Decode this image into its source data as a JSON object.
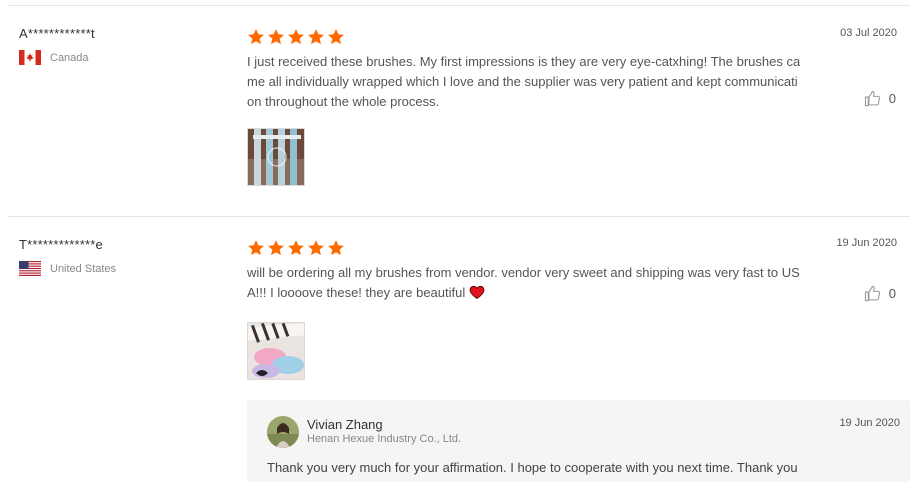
{
  "reviews": [
    {
      "user": "A************t",
      "country": "Canada",
      "rating": 5,
      "date": "03 Jul 2020",
      "text": "I just received these brushes. My first impressions is they are very eye-catxhing! The brushes came all individually wrapped which I love and the supplier was very patient and kept communication throughout the whole process.",
      "likes": "0",
      "photo_icon": "brush-photo"
    },
    {
      "user": "T*************e",
      "country": "United States",
      "rating": 5,
      "date": "19 Jun 2020",
      "text": "will be ordering all my brushes from vendor. vendor very sweet and shipping was very fast to USA!!! I loooove these! they are beautiful",
      "likes": "0",
      "photo_icon": "brush-photo",
      "reply": {
        "name": "Vivian Zhang",
        "company": "Henan Hexue Industry Co., Ltd.",
        "date": "19 Jun 2020",
        "text": "Thank you very much for your affirmation. I hope to cooperate with you next time. Thank you"
      }
    }
  ],
  "colors": {
    "star": "#ff6a00",
    "divider": "#e6e6e6",
    "reply_bg": "#f5f5f5",
    "heart": "#e0141e"
  },
  "icons": {
    "star": "star-icon",
    "like": "thumbs-up-icon",
    "heart": "heart-emoji-icon"
  }
}
